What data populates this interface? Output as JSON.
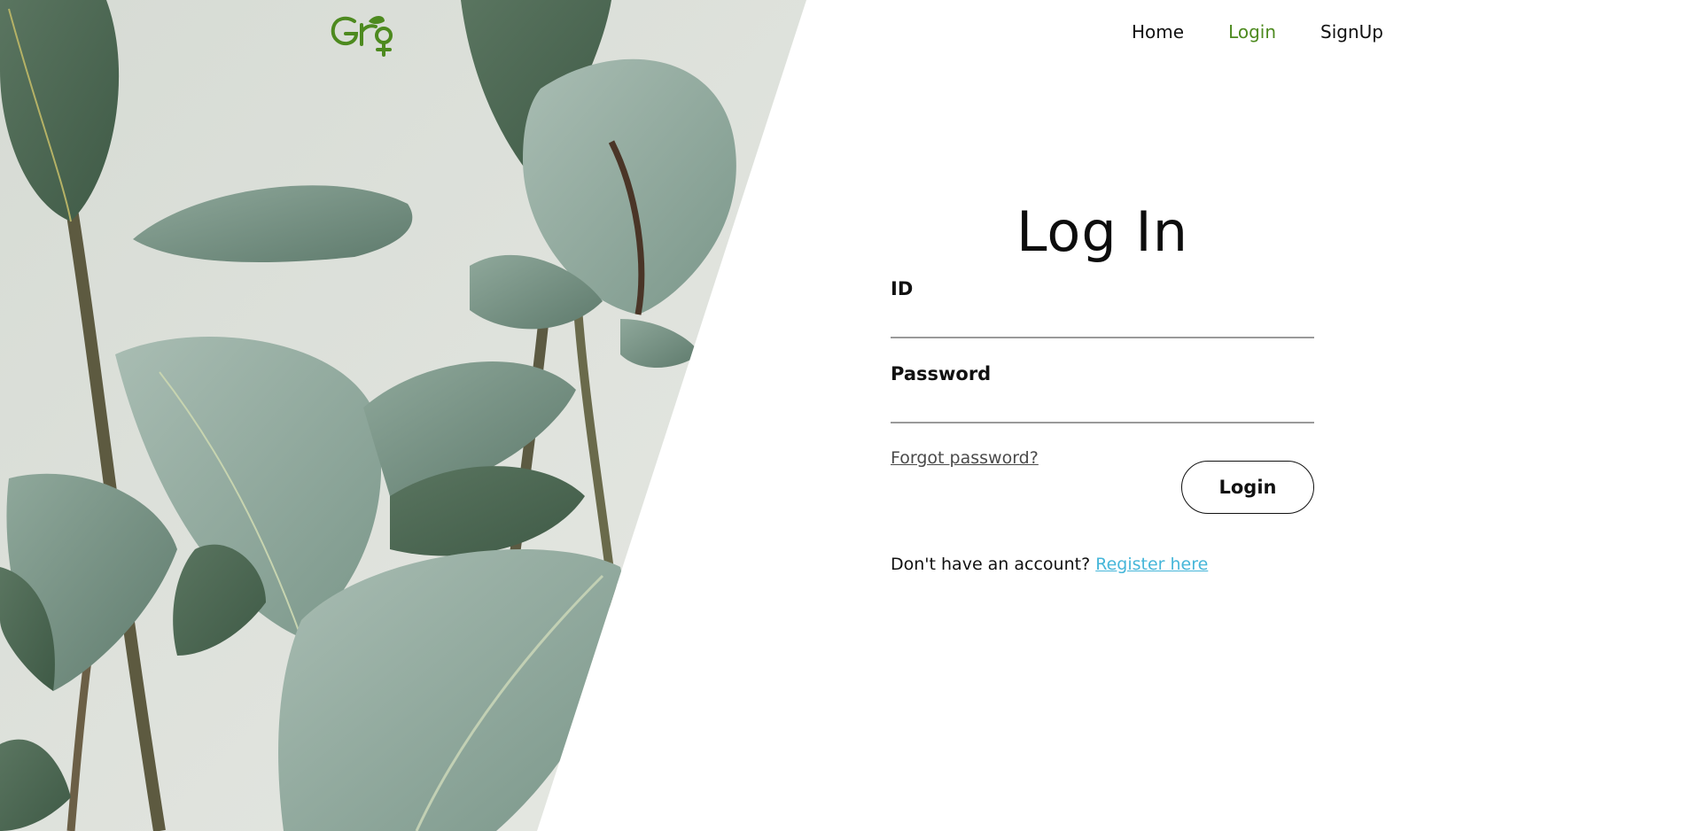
{
  "brand": {
    "logo_alt": "Gro",
    "logo_color": "#4d8a1f"
  },
  "nav": {
    "items": [
      {
        "label": "Home",
        "active": false
      },
      {
        "label": "Login",
        "active": true
      },
      {
        "label": "SignUp",
        "active": false
      }
    ],
    "active_color": "#4d8a1f"
  },
  "login": {
    "title": "Log In",
    "id_label": "ID",
    "id_value": "",
    "password_label": "Password",
    "password_value": "",
    "forgot_label": "Forgot password?",
    "submit_label": "Login",
    "register_prompt": "Don't have an account?",
    "register_link": "Register here",
    "link_color": "#46b6d9"
  },
  "hero": {
    "subject": "rubber plant leaves photo",
    "background_color": "#dfe3de",
    "leaf_color": "#6f8f80"
  }
}
